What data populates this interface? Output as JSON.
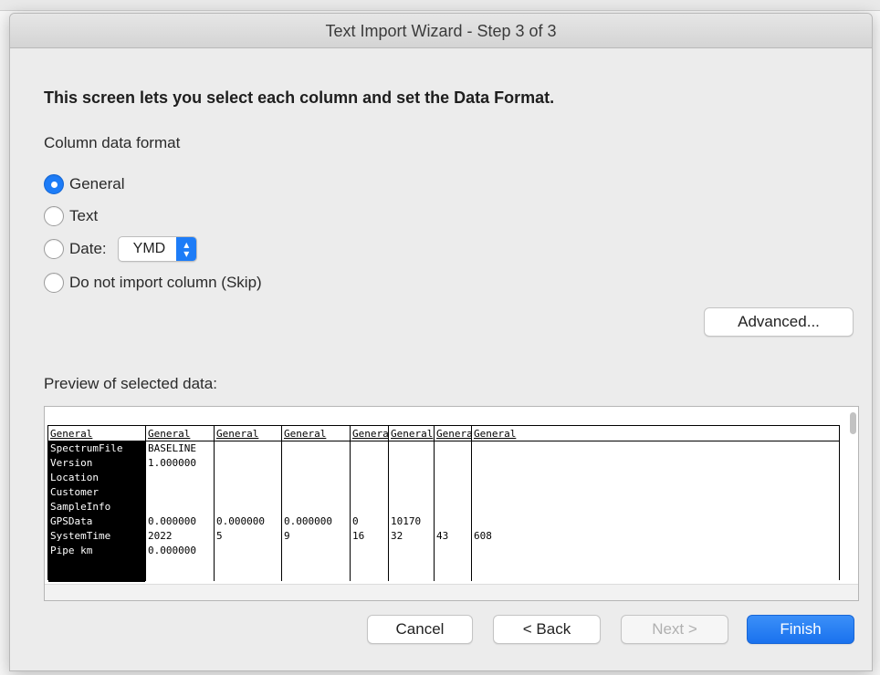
{
  "window": {
    "title": "Text Import Wizard - Step 3 of 3"
  },
  "heading": "This screen lets you select each column and set the Data Format.",
  "column_format": {
    "label": "Column data format",
    "options": [
      {
        "label": "General",
        "checked": true
      },
      {
        "label": "Text",
        "checked": false
      },
      {
        "label": "Date:",
        "checked": false
      },
      {
        "label": "Do not import column (Skip)",
        "checked": false
      }
    ],
    "date_select": {
      "value": "YMD"
    }
  },
  "advanced_label": "Advanced...",
  "preview": {
    "label": "Preview of selected data:",
    "columns": [
      {
        "header": "General",
        "cells": [
          "SpectrumFile",
          "Version",
          "Location",
          "Customer",
          "SampleInfo",
          "GPSData",
          "SystemTime",
          "Pipe km"
        ]
      },
      {
        "header": "General",
        "cells": [
          "BASELINE",
          "1.000000",
          "",
          "",
          "",
          "0.000000",
          "2022",
          "0.000000"
        ]
      },
      {
        "header": "General",
        "cells": [
          "",
          "",
          "",
          "",
          "",
          "0.000000",
          "5",
          ""
        ]
      },
      {
        "header": "General",
        "cells": [
          "",
          "",
          "",
          "",
          "",
          "0.000000",
          "9",
          ""
        ]
      },
      {
        "header": "General",
        "cells": [
          "",
          "",
          "",
          "",
          "",
          "0",
          "16",
          ""
        ]
      },
      {
        "header": "General",
        "cells": [
          "",
          "",
          "",
          "",
          "",
          "10170",
          "32",
          ""
        ]
      },
      {
        "header": "General",
        "cells": [
          "",
          "",
          "",
          "",
          "",
          "",
          "43",
          ""
        ]
      },
      {
        "header": "General",
        "cells": [
          "",
          "",
          "",
          "",
          "",
          "",
          "608",
          ""
        ]
      }
    ]
  },
  "buttons": {
    "cancel": "Cancel",
    "back": "< Back",
    "next": "Next >",
    "finish": "Finish"
  },
  "colors": {
    "accent": "#1d7cf7",
    "dialog_bg": "#ececec"
  }
}
